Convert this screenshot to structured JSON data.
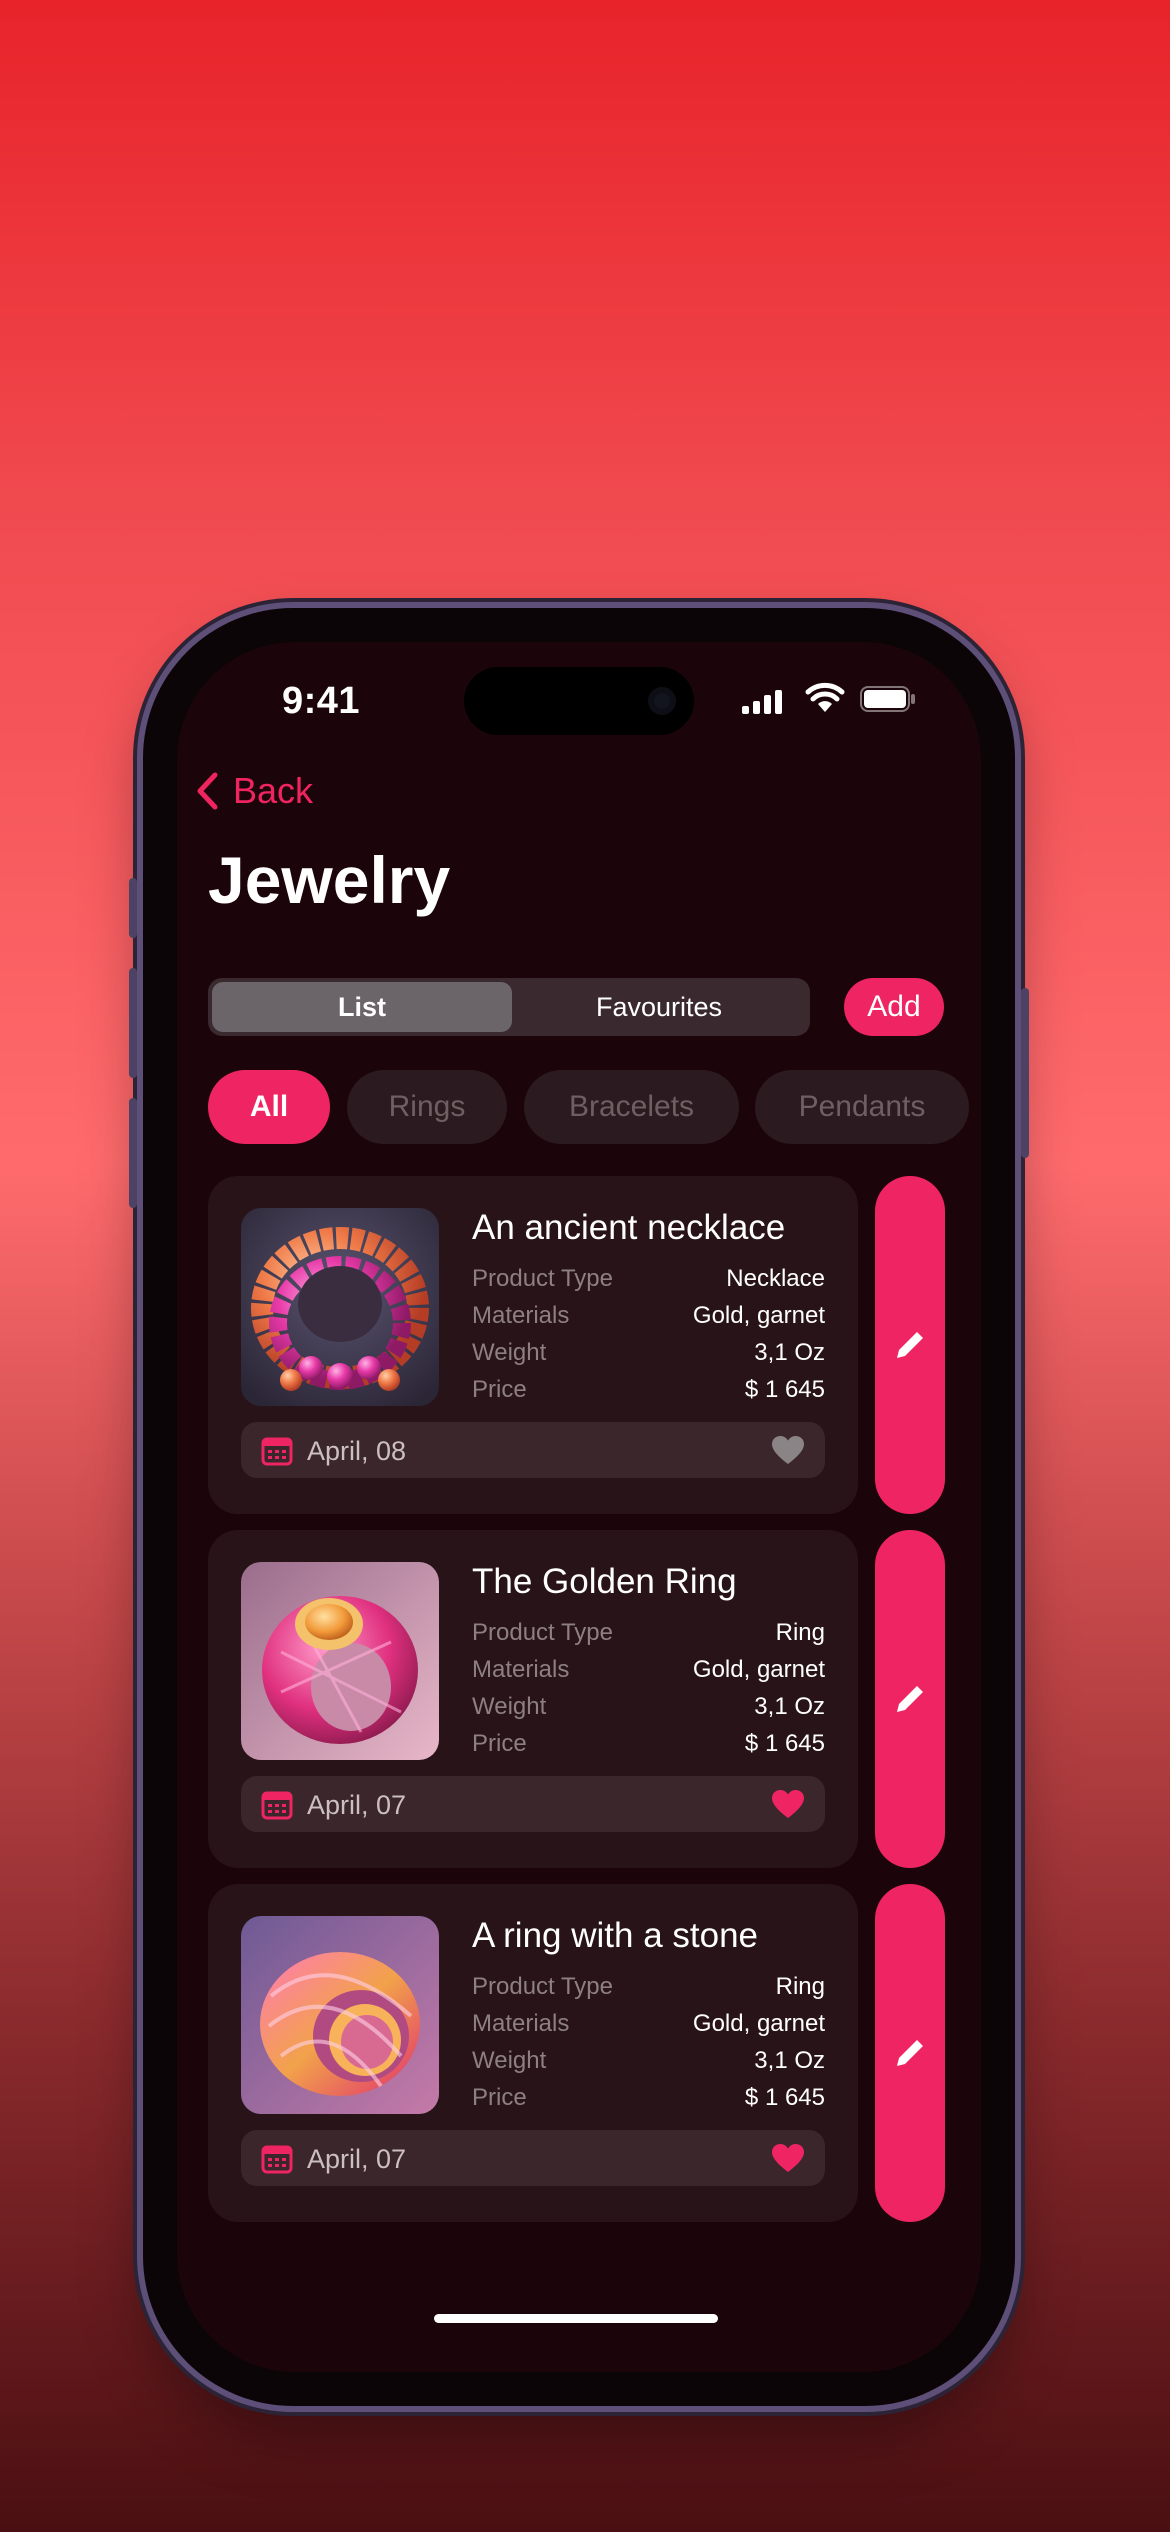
{
  "status_bar": {
    "time": "9:41"
  },
  "nav": {
    "back_label": "Back",
    "title": "Jewelry"
  },
  "segmented": {
    "list_label": "List",
    "favourites_label": "Favourites",
    "selected": "List"
  },
  "add_label": "Add",
  "filters": [
    {
      "label": "All",
      "active": true
    },
    {
      "label": "Rings",
      "active": false
    },
    {
      "label": "Bracelets",
      "active": false
    },
    {
      "label": "Pendants",
      "active": false
    }
  ],
  "field_labels": {
    "type": "Product Type",
    "materials": "Materials",
    "weight": "Weight",
    "price": "Price"
  },
  "products": [
    {
      "name": "An ancient necklace",
      "type": "Necklace",
      "materials": "Gold, garnet",
      "weight": "3,1 Oz",
      "price": "$ 1 645",
      "date": "April, 08",
      "favourite": false,
      "image_icon": "necklace-image"
    },
    {
      "name": "The Golden Ring",
      "type": "Ring",
      "materials": "Gold, garnet",
      "weight": "3,1 Oz",
      "price": "$ 1 645",
      "date": "April, 07",
      "favourite": true,
      "image_icon": "ring-image"
    },
    {
      "name": "A ring with a stone",
      "type": "Ring",
      "materials": "Gold, garnet",
      "weight": "3,1 Oz",
      "price": "$ 1 645",
      "date": "April, 07",
      "favourite": true,
      "image_icon": "ring-image"
    }
  ],
  "colors": {
    "accent": "#ee2463",
    "card": "#271318",
    "screen": "#1b050a",
    "heart_inactive": "#8a8487"
  }
}
